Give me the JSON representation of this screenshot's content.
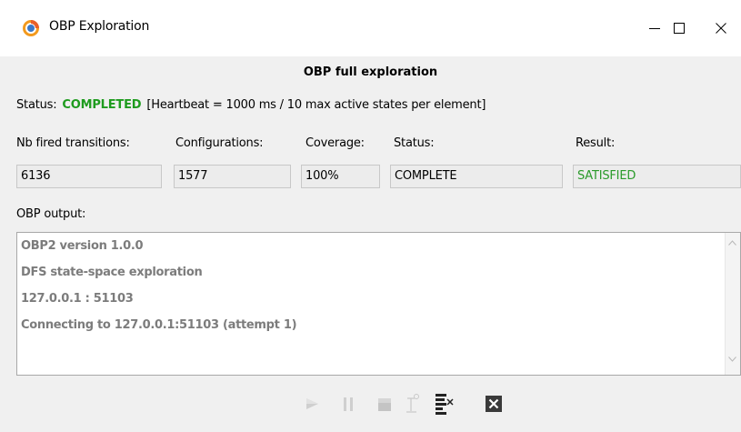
{
  "window": {
    "title": "OBP Exploration",
    "controls": {
      "minimize": "—",
      "maximize": "□",
      "close": "✕"
    }
  },
  "main": {
    "heading": "OBP full exploration",
    "status_prefix": "Status:",
    "status_value": "COMPLETED",
    "status_details": "[Heartbeat = 1000 ms / 10 max active states per element]",
    "labels": {
      "transitions": "Nb fired transitions:",
      "configurations": "Configurations:",
      "coverage": "Coverage:",
      "status": "Status:",
      "result": "Result:"
    },
    "fields": {
      "transitions": "6136",
      "configurations": "1577",
      "coverage": "100%",
      "status": "COMPLETE",
      "result": "SATISFIED"
    },
    "output_label": "OBP output:",
    "output_lines": [
      "OBP2 version 1.0.0",
      "DFS state-space exploration",
      "127.0.0.1 : 51103",
      "Connecting to 127.0.0.1:51103 (attempt 1)"
    ]
  },
  "toolbar": {
    "icons": [
      "play-icon",
      "pause-icon",
      "stop-icon",
      "step-icon",
      "trace-icon",
      "close-icon"
    ]
  },
  "colors": {
    "completed": "#1e9b1e",
    "satisfied": "#2a9a2a",
    "output_text": "#7c7c7c"
  }
}
